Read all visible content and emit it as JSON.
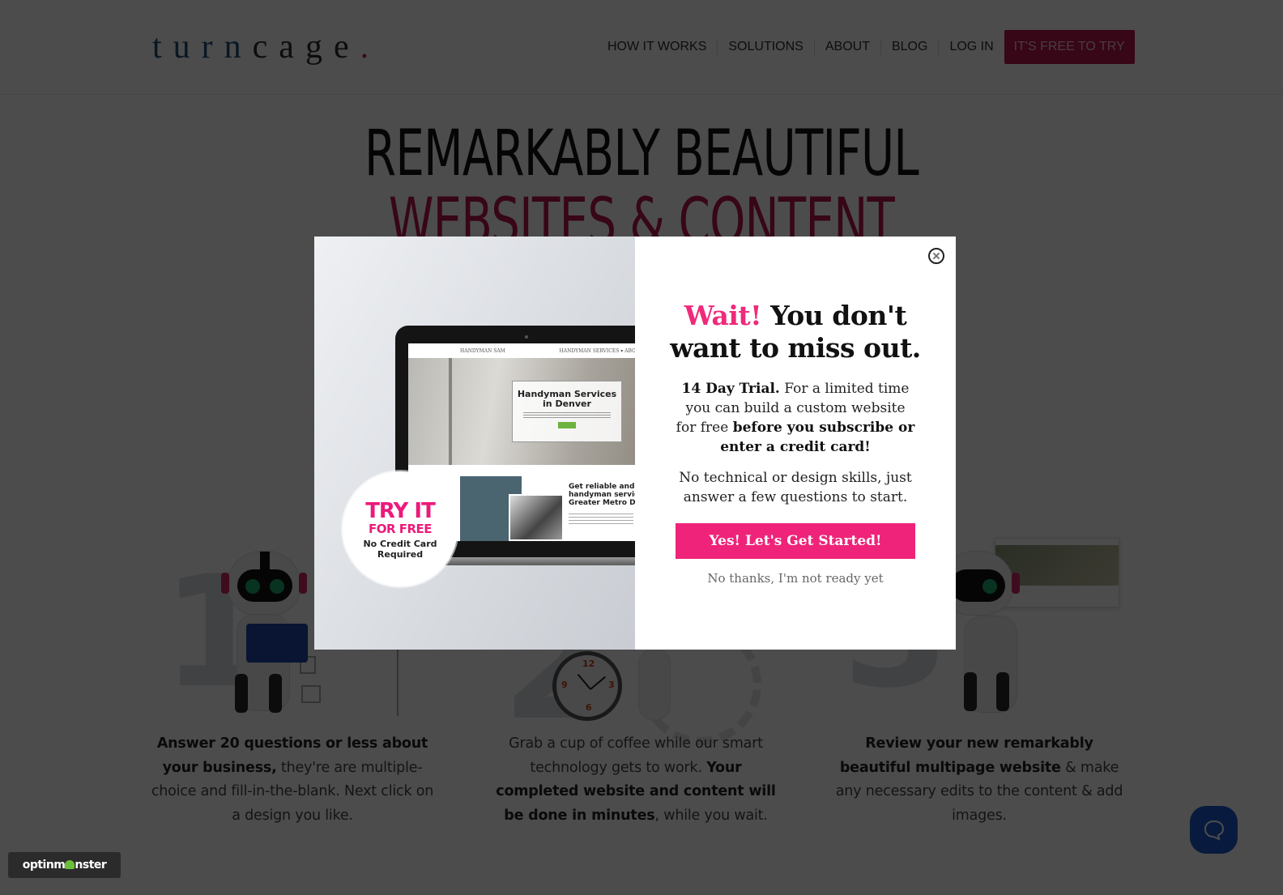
{
  "header": {
    "logo_part1": "turn",
    "logo_part2": "cage",
    "logo_dot": ".",
    "nav": [
      {
        "label": "HOW IT WORKS"
      },
      {
        "label": "SOLUTIONS"
      },
      {
        "label": "ABOUT"
      },
      {
        "label": "BLOG"
      },
      {
        "label": "LOG IN"
      }
    ],
    "cta_label": "IT'S FREE TO TRY"
  },
  "hero": {
    "line1": "REMARKABLY BEAUTIFUL",
    "line2": "WEBSITES & CONTENT"
  },
  "steps": [
    {
      "number": "1",
      "text_bold": "Answer 20 questions or less about your business,",
      "text_rest": " they're are multiple-choice and fill-in-the-blank. Next click on a design you like."
    },
    {
      "number": "2",
      "text_pre": "Grab a cup of coffee while our smart technology gets to work. ",
      "text_bold": "Your completed website and content will be done in minutes",
      "text_rest": ", while you wait."
    },
    {
      "number": "3",
      "text_bold": "Review your new remarkably beautiful multipage website",
      "text_rest": " & make any necessary edits to the content & add images."
    }
  ],
  "clock": {
    "n12": "12",
    "n3": "3",
    "n6": "6",
    "n9": "9"
  },
  "modal": {
    "image": {
      "site_brand": "HANDYMAN SAM",
      "site_nav": "HANDYMAN SERVICES ▾   ABOUT",
      "hero_title_1": "Handyman Services",
      "hero_title_2": "in Denver",
      "section_heading_1": "Get reliable and affordable",
      "section_heading_2": "handyman services in",
      "section_heading_3": "Greater Metro Denver",
      "badge_line1": "TRY IT",
      "badge_line2": "FOR FREE",
      "badge_line3": "No Credit Card",
      "badge_line4": "Required"
    },
    "title_accent": "Wait!",
    "title_rest_1": " You don't",
    "title_rest_2": "want to miss out.",
    "p1_bold": "14 Day Trial.",
    "p1_text": " For a limited time you can build a custom website for free ",
    "p1_bold2": "before you subscribe or enter a credit card!",
    "p2": "No technical or design skills, just answer a few questions to start.",
    "cta_label": "Yes! Let's Get Started!",
    "decline_label": "No thanks, I'm not ready yet"
  },
  "optinmonster": {
    "part1": "optinm",
    "part2": "nster"
  },
  "colors": {
    "brand_pink": "#ef2379",
    "brand_maroon": "#b8154f",
    "logo_blue": "#1f4e7a",
    "chat_blue": "#1b5bd0"
  }
}
